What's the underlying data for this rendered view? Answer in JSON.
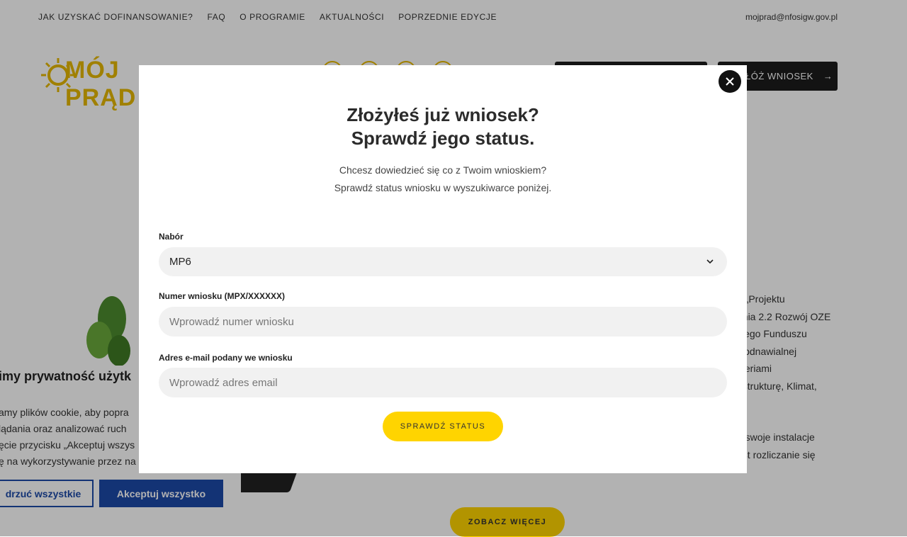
{
  "topnav": {
    "links": [
      "JAK UZYSKAĆ DOFINANSOWANIE?",
      "FAQ",
      "O PROGRAMIE",
      "AKTUALNOŚCI",
      "POPRZEDNIE EDYCJE"
    ],
    "email": "mojprad@nfosigw.gov.pl"
  },
  "header": {
    "logo_text": "MÓJ PRĄD",
    "apply_button": "ZŁÓŻ WNIOSEK"
  },
  "background": {
    "right_text": [
      "n „Projektu",
      "ania 2.2 Rozwój OZE",
      "kiego Funduszu",
      "ii odnawialnej",
      "yteriami",
      "astrukturę, Klimat,"
    ],
    "right_text2": [
      "a swoje instalacje",
      "est rozliczanie się"
    ],
    "see_more": "ZOBACZ WIĘCEJ"
  },
  "cookie": {
    "title": "imy prywatność użytk",
    "text": [
      "amy plików cookie, aby popra",
      "lądania oraz analizować ruch",
      "ęcie przycisku „Akceptuj wszys",
      "ę na wykorzystywanie przez na"
    ],
    "reject": "drzuć wszystkie",
    "accept": "Akceptuj wszystko"
  },
  "modal": {
    "title_line1": "Złożyłeś już wniosek?",
    "title_line2": "Sprawdź jego status.",
    "subtitle_line1": "Chcesz dowiedzieć się co z Twoim wnioskiem?",
    "subtitle_line2": "Sprawdź status wniosku w wyszukiwarce poniżej.",
    "nabor_label": "Nabór",
    "nabor_value": "MP6",
    "number_label": "Numer wniosku (MPX/XXXXXX)",
    "number_placeholder": "Wprowadź numer wniosku",
    "email_label": "Adres e-mail podany we wniosku",
    "email_placeholder": "Wprowadź adres email",
    "submit": "SPRAWDŹ STATUS"
  },
  "colors": {
    "accent": "#ffd400",
    "brand_blue": "#1c49a8",
    "dark": "#1c1c1c"
  }
}
